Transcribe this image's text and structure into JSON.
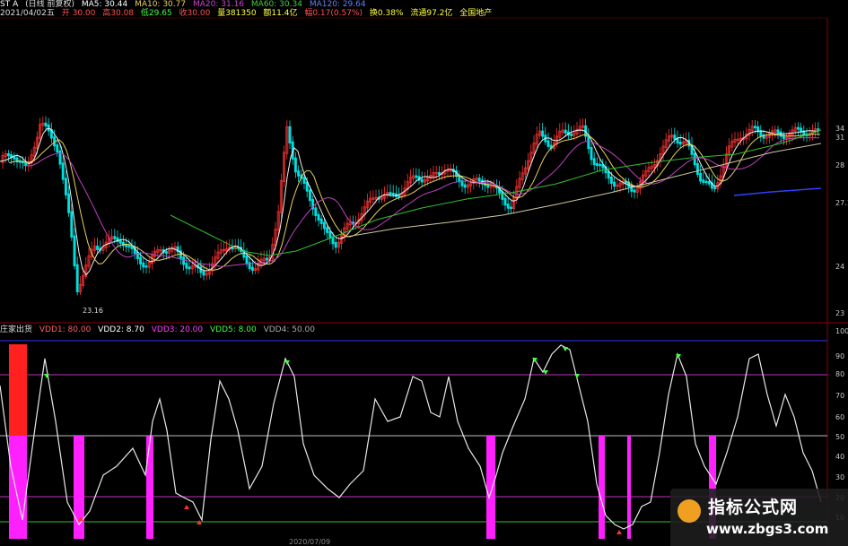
{
  "header_line1": {
    "symbol": "ST A",
    "mode": "(日线 前复权)",
    "ma5": "MA5: 30.44",
    "ma10": "MA10: 30.77",
    "ma20": "MA20: 31.16",
    "ma60": "MA60: 30.34",
    "ma120": "MA120: 29.64"
  },
  "header_line2": {
    "date": "2021/04/02五",
    "open": "开 30.00",
    "high": "高30.08",
    "low": "低29.65",
    "close": "收30.00",
    "volume": "量381350",
    "amount": "额11.4亿",
    "change": "幅0.17(0.57%)",
    "turnover": "换0.38%",
    "float": "流通97.2亿",
    "sector": "全国地产"
  },
  "main_chart": {
    "low_label": "23.16",
    "right_axis": [
      "34",
      "31",
      "28",
      "27.1",
      "24",
      "23"
    ]
  },
  "indicator": {
    "name": "庄家出货",
    "params": [
      {
        "text": "VDD1: 80.00",
        "color": "#ff6060"
      },
      {
        "text": "VDD2: 8.70",
        "color": "#ffffff"
      },
      {
        "text": "VDD3: 20.00",
        "color": "#ff40ff"
      },
      {
        "text": "VDD5: 8.00",
        "color": "#40ff40"
      },
      {
        "text": "VDD4: 50.00",
        "color": "#aaaaaa"
      }
    ],
    "right_axis": [
      "100",
      "90",
      "80",
      "70",
      "60",
      "50",
      "40",
      "30",
      "20",
      "10"
    ]
  },
  "bottom_date": "2020/07/09",
  "colors": {
    "up": "#ff3232",
    "down": "#00e0e0",
    "ma_white": "#f0f0f0",
    "ma_yellow": "#e6d060",
    "ma_purple": "#c040c0",
    "ma_green": "#30c030",
    "magenta": "#ff20ff"
  },
  "watermark": {
    "title": "指标公式网",
    "url": "www.zbgs3.com"
  }
}
